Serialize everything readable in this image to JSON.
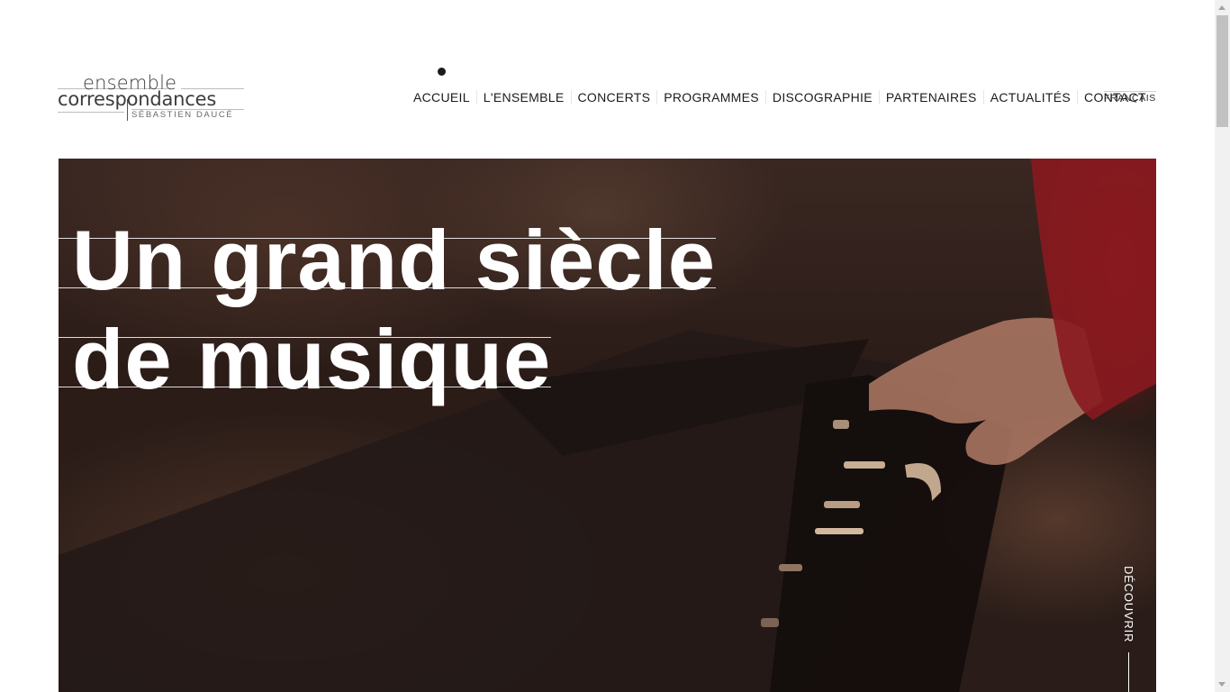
{
  "logo": {
    "line1": "ensemble",
    "line2": "correspondances",
    "line3": "SÉBASTIEN DAUCÉ"
  },
  "nav": {
    "active": "ACCUEIL",
    "items": [
      {
        "label": "ACCUEIL"
      },
      {
        "label": "L'ENSEMBLE"
      },
      {
        "label": "CONCERTS"
      },
      {
        "label": "PROGRAMMES"
      },
      {
        "label": "DISCOGRAPHIE"
      },
      {
        "label": "PARTENAIRES"
      },
      {
        "label": "ACTUALITÉS"
      },
      {
        "label": "CONTACT"
      }
    ],
    "language": "FRANÇAIS"
  },
  "hero": {
    "title_line1": "Un grand siècle",
    "title_line2": "de musique",
    "discover": "DÉCOUVRIR"
  }
}
